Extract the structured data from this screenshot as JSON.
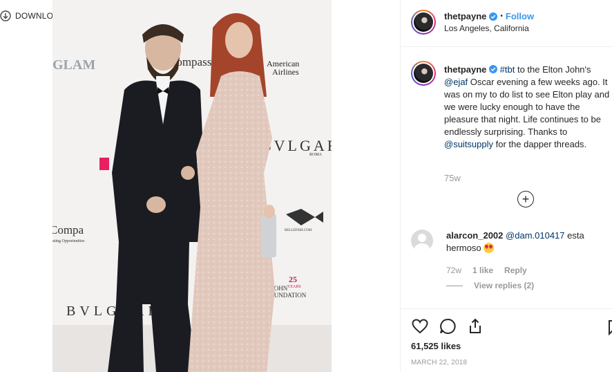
{
  "download": {
    "label": "DOWNLOAD"
  },
  "photo": {
    "backdrop_text": [
      "GLAM",
      "Compass",
      "American",
      "Airlines",
      "BVLGARI",
      "ROMA",
      "Compa",
      "ating Opportunities",
      "25",
      "YEARS",
      "ON JOHN",
      "S FOUNDATION",
      "BVLGARI",
      "BELLEFISH.COM"
    ]
  },
  "header": {
    "username": "thetpayne",
    "separator": "•",
    "follow_label": "Follow",
    "location": "Los Angeles, California"
  },
  "caption": {
    "username": "thetpayne",
    "hashtag": "#tbt",
    "text1": " to the Elton John's ",
    "mention1": "@ejaf",
    "text2": " Oscar evening a few weeks ago. It was on my to do list to see Elton play and we were lucky enough to have the pleasure that night. Life continues to be endlessly surprising. Thanks to ",
    "mention2": "@suitsupply",
    "text3": " for the dapper threads.",
    "time": "75w"
  },
  "load_more": {
    "symbol": "+"
  },
  "comment": {
    "username": "alarcon_2002",
    "mention": "@dam.010417",
    "text": " esta hermoso ",
    "time": "72w",
    "likes": "1 like",
    "reply": "Reply",
    "view_replies": "View replies (2)"
  },
  "actions": {
    "likes": "61,525 likes",
    "date": "MARCH 22, 2018"
  },
  "colors": {
    "link": "#003569",
    "follow": "#3897f0",
    "verified": "#3897f0",
    "muted": "#999999"
  },
  "icons": [
    "download-icon",
    "verified-icon",
    "plus-circle-icon",
    "heart-icon",
    "comment-icon",
    "share-icon",
    "bookmark-icon",
    "avatar",
    "heart-eyes-emoji"
  ]
}
